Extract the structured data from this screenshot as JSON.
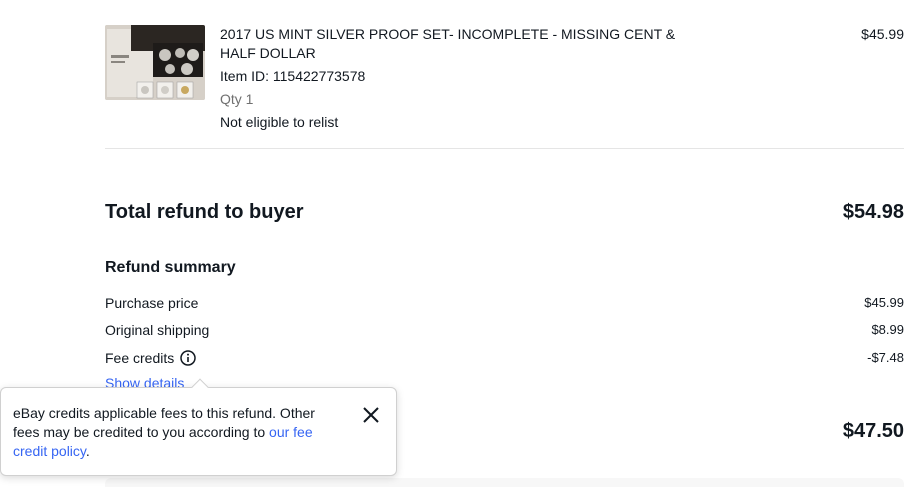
{
  "item": {
    "title": "2017 US MINT SILVER PROOF SET- INCOMPLETE -  MISSING CENT & HALF DOLLAR",
    "item_id": "Item ID: 115422773578",
    "qty": "Qty 1",
    "relist": "Not eligible to relist",
    "price": "$45.99",
    "thumbnail_icon": "coin-set-photo"
  },
  "total": {
    "label": "Total refund to buyer",
    "value": "$54.98"
  },
  "summary": {
    "title": "Refund summary",
    "rows": [
      {
        "label": "Purchase price",
        "value": "$45.99"
      },
      {
        "label": "Original shipping",
        "value": "$8.99"
      },
      {
        "label": "Fee credits",
        "value": "-$7.48"
      }
    ],
    "show_details": "Show details"
  },
  "bottom_total": {
    "value": "$47.50"
  },
  "tooltip": {
    "text": "eBay credits applicable fees to this refund. Other fees may be credited to you according to ",
    "link": "our fee credit policy",
    "suffix": ".",
    "close_icon": "close-icon"
  },
  "colors": {
    "link": "#3665f3",
    "text": "#111820",
    "muted": "#707070"
  }
}
